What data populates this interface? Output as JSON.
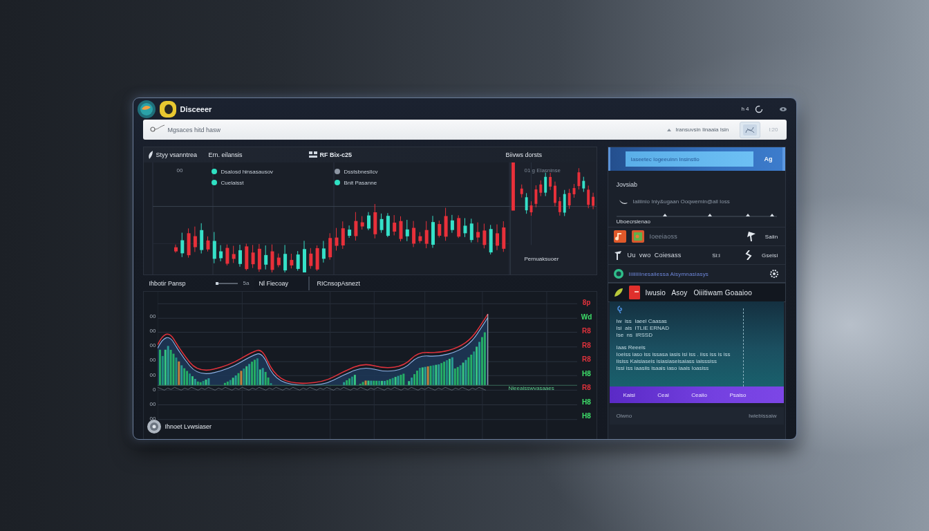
{
  "window": {
    "title": "Disceeer",
    "status": "h 4"
  },
  "search": {
    "placeholder": "Mgsaces hitd hasw",
    "hint": "Iransuvsin Iinaaia Isin",
    "time": "I:20"
  },
  "market": {
    "headers": [
      "Styy vsanntrea",
      "Ern. eilansis",
      "RF Bix-c25",
      "Biivws dorsts"
    ],
    "axis_label": "00",
    "legend": [
      {
        "label": "Dsalosd hinsasausov",
        "color": "#2fe0c2"
      },
      {
        "label": "Cuelaisst",
        "color": "#2fe0c2"
      },
      {
        "label": "Dsstsbnesllcv",
        "color": "#8d96a3"
      },
      {
        "label": "Bnit Pasanne",
        "color": "#2fe0c2"
      }
    ],
    "side": {
      "label": "01 g Elasninse",
      "caption": "Pernuaksuoer"
    }
  },
  "toolbar": {
    "label": "Ihbotir Pansp",
    "slider": {
      "level": 0.15
    },
    "reading": "5a",
    "field": {
      "value": "Nl Fiecoay"
    },
    "link": "RICnsopAsnezt"
  },
  "volume": {
    "left_ticks": [
      "00",
      "00",
      "00",
      "00",
      "00",
      "0",
      "00",
      "00"
    ],
    "right_ticks": [
      {
        "text": "8p",
        "color": "#e0323c"
      },
      {
        "text": "Wd",
        "color": "#3ee06a"
      },
      {
        "text": "R8",
        "color": "#e0323c"
      },
      {
        "text": "R8",
        "color": "#e0323c"
      },
      {
        "text": "R8",
        "color": "#e0323c"
      },
      {
        "text": "H8",
        "color": "#3ee06a"
      },
      {
        "text": "R8",
        "color": "#e0323c"
      },
      {
        "text": "H8",
        "color": "#3ee06a"
      },
      {
        "text": "H8",
        "color": "#3ee06a"
      }
    ],
    "caption": "Nleeaisswvasaaes",
    "footer": "Ihnoet Lvwsiaser"
  },
  "sidebar": {
    "banner": {
      "placeholder": "Iaseetec Iogeeuinn Insinstlo",
      "button": "Ag"
    },
    "title": "Jovsiab",
    "account": "Iaiiiinio Iniy&ugaan Ooqwemin@ail Ioss",
    "section": "Uboecrsienao",
    "rows": [
      {
        "kind": "apps",
        "text": "Ioeeiaoss",
        "value": "Saiin",
        "selected": false
      },
      {
        "kind": "pin",
        "text": "Uu  vwo  Coiesass",
        "meta": "Si:i",
        "value": "Gseisi",
        "selected": false
      },
      {
        "kind": "link",
        "text": "Iiiiiiiiinesaiiessa Aisymnasiasys",
        "selected": false
      },
      {
        "kind": "file",
        "text": "Iwusio   Asoy   Oiiitiwam Goaaioo",
        "selected": true
      }
    ],
    "notes": {
      "lines": [
        "Iw  iss  Iaeel Caasas",
        "Isi  ais  ITLIE ERNAD",
        "Ise  ns  IRSSD"
      ],
      "heading": "Iaas Reeeis",
      "details": [
        "Ioeiss iaso iss issasa iasis isi iss . iiss iss is iss",
        "Iisiss Kaisiaseis isiasiaseisaiass iaisssiss",
        "Issi iss iaasiis isaais iaso iaais Ioasiss"
      ]
    },
    "actions": [
      "Kaisi",
      "Ceai",
      "Ceaiio",
      "Psaiso"
    ],
    "footer": {
      "left": "Oiwno",
      "right": "Iwiebissaiw"
    }
  }
}
